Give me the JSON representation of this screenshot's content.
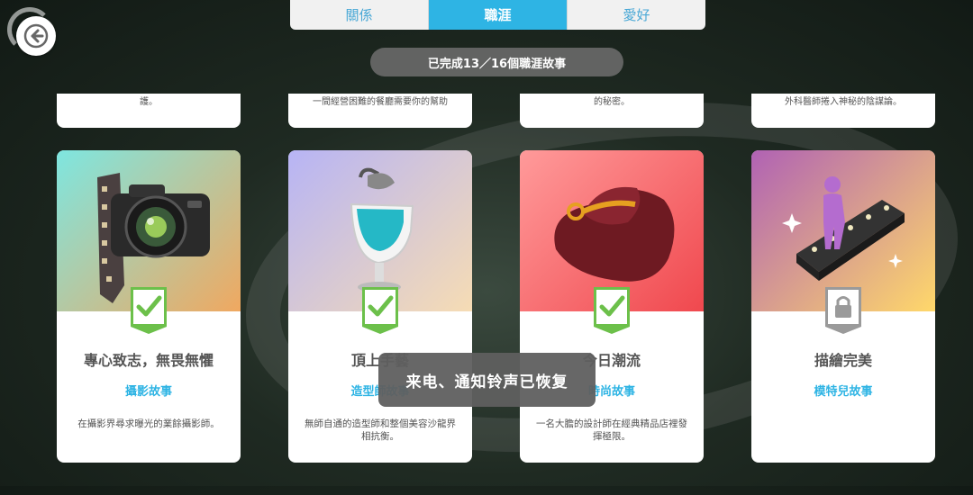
{
  "tabs": [
    {
      "label": "關係",
      "active": false
    },
    {
      "label": "職涯",
      "active": true
    },
    {
      "label": "愛好",
      "active": false
    }
  ],
  "progress_text": "已完成13／16個職涯故事",
  "top_cards": [
    {
      "text": "護。"
    },
    {
      "text": "一間經營困難的餐廳需要你的幫助"
    },
    {
      "text": "的秘密。"
    },
    {
      "text": "外科醫師捲入神秘的陰謀論。"
    }
  ],
  "cards": [
    {
      "title": "專心致志，無畏無懼",
      "subtitle": "攝影故事",
      "description": "在攝影界尋求曝光的業餘攝影師。",
      "badge": "check",
      "icon": "camera-icon",
      "gradient": [
        "#7ee6e0",
        "#f0a860"
      ]
    },
    {
      "title": "頂上手藝",
      "subtitle": "造型師故事",
      "description": "無師自通的造型師和整個美容沙龍界相抗衡。",
      "badge": "check",
      "icon": "salon-chair-icon",
      "gradient": [
        "#b7b4f5",
        "#f6dcb4"
      ]
    },
    {
      "title": "今日潮流",
      "subtitle": "時尚故事",
      "description": "一名大膽的設計師在經典精品店裡發揮極限。",
      "badge": "check",
      "icon": "hat-icon",
      "gradient": [
        "#ff9a9a",
        "#f0484e"
      ]
    },
    {
      "title": "描繪完美",
      "subtitle": "模特兒故事",
      "description": "",
      "badge": "lock",
      "icon": "runway-model-icon",
      "gradient": [
        "#b062b4",
        "#ffd86a"
      ]
    }
  ],
  "toast_text": "来电、通知铃声已恢复",
  "colors": {
    "accent": "#2eb4e4",
    "badge_green": "#6cc04a",
    "badge_gray": "#9a9a9a"
  }
}
